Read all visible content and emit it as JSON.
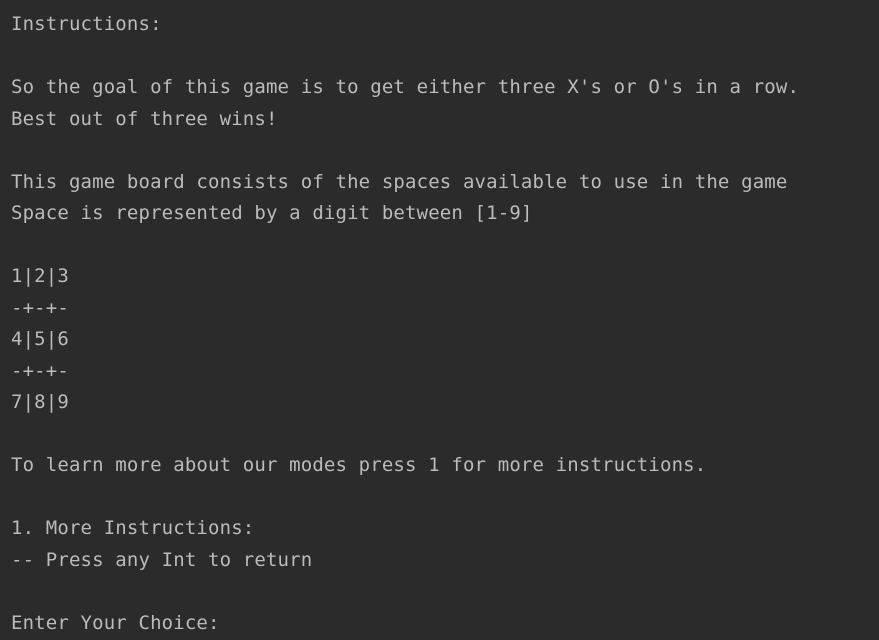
{
  "console": {
    "instructions_title": "Instructions:",
    "goal_line": "So the goal of this game is to get either three X's or O's in a row.",
    "best_of_line": "Best out of three wins!",
    "board_desc_line": "This game board consists of the spaces available to use in the game",
    "space_line": "Space is represented by a digit between [1-9]",
    "board": {
      "row1": "1|2|3",
      "sep1": "-+-+-",
      "row2": "4|5|6",
      "sep2": "-+-+-",
      "row3": "7|8|9"
    },
    "modes_line": "To learn more about our modes press 1 for more instructions.",
    "option_1": "1. More Instructions:",
    "option_return": "-- Press any Int to return",
    "prompt": "Enter Your Choice:"
  }
}
